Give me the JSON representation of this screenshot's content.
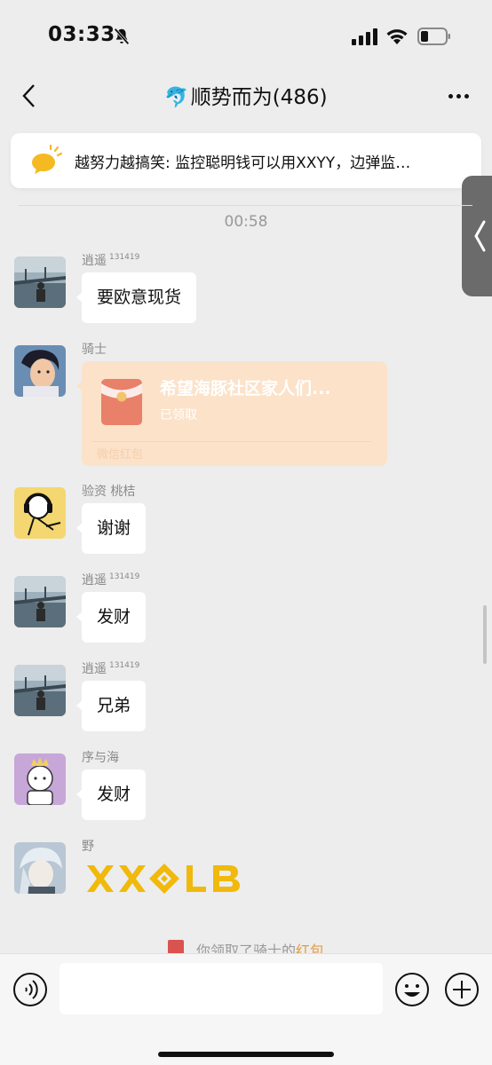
{
  "status_bar": {
    "time": "03:33"
  },
  "nav": {
    "title_emoji": "🐬",
    "title": "顺势而为(486)"
  },
  "announcement": {
    "text": "越努力越搞笑: 监控聪明钱可以用XXYY，边弹监…"
  },
  "chat": {
    "timestamp": "00:58",
    "messages": [
      {
        "sender": "逍遥",
        "badge": "131419",
        "text": "要欧意现货"
      },
      {
        "sender": "骑士",
        "type": "red_packet",
        "rp_title": "希望海豚社区家人们...",
        "rp_status": "已领取",
        "rp_label": "微信红包"
      },
      {
        "sender": "验资 桃桔",
        "text": "谢谢"
      },
      {
        "sender": "逍遥",
        "badge": "131419",
        "text": "发财"
      },
      {
        "sender": "逍遥",
        "badge": "131419",
        "text": "兄弟"
      },
      {
        "sender": "序与海",
        "text": "发财"
      },
      {
        "sender": "野",
        "type": "image",
        "image_text": "XX◈LB"
      }
    ],
    "system_notice": {
      "prefix": "你领取了骑士的",
      "link": "红包"
    }
  },
  "colors": {
    "red_packet_bg": "#fbe2c9",
    "logo_gold": "#f0b90b",
    "background": "#ededed"
  },
  "input": {
    "value": "",
    "placeholder": ""
  }
}
